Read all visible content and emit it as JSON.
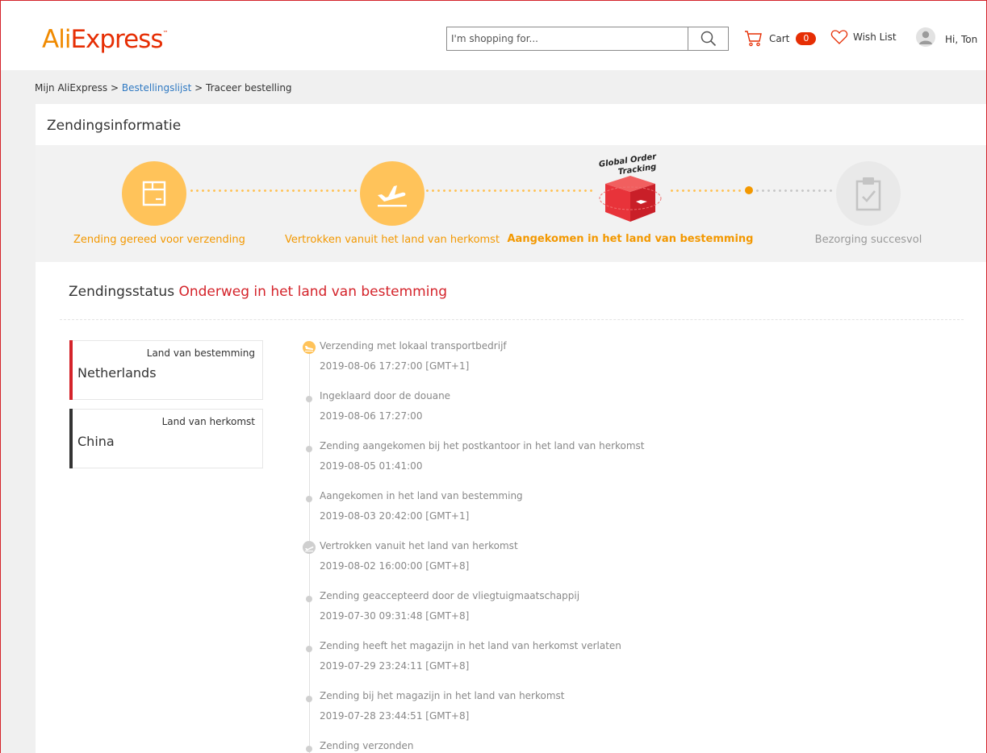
{
  "header": {
    "logo_text_ali": "Ali",
    "logo_text_express": "Express",
    "search_placeholder": "I'm shopping for...",
    "cart_label": "Cart",
    "cart_count": "0",
    "wishlist_label": "Wish List",
    "greeting": "Hi, Ton"
  },
  "breadcrumb": {
    "root": "Mijn AliExpress",
    "sep1": ">",
    "orders": "Bestellingslijst",
    "sep2": ">",
    "current": "Traceer bestelling"
  },
  "panel": {
    "title": "Zendingsinformatie"
  },
  "steps": [
    {
      "label": "Zending gereed voor verzending",
      "state": "done",
      "icon": "package-icon"
    },
    {
      "label": "Vertrokken vanuit het land van herkomst",
      "state": "done",
      "icon": "plane-departure-icon"
    },
    {
      "label": "Aangekomen in het land van bestemming",
      "state": "current",
      "icon": "global-order-tracking-icon",
      "badge_line1": "Global Order",
      "badge_line2": "Tracking"
    },
    {
      "label": "Bezorging succesvol",
      "state": "pending",
      "icon": "clipboard-check-icon"
    }
  ],
  "status": {
    "label": "Zendingsstatus",
    "value": "Onderweg in het land van bestemming"
  },
  "countries": {
    "destination": {
      "caption": "Land van bestemming",
      "name": "Netherlands",
      "accent": "#d4232a"
    },
    "origin": {
      "caption": "Land van herkomst",
      "name": "China",
      "accent": "#333333"
    }
  },
  "events": [
    {
      "desc": "Verzending met lokaal transportbedrijf",
      "time": "2019-08-06 17:27:00 [GMT+1]",
      "marker": "plane-landing-icon-active"
    },
    {
      "desc": "Ingeklaard door de douane",
      "time": "2019-08-06 17:27:00",
      "marker": "dot"
    },
    {
      "desc": "Zending aangekomen bij het postkantoor in het land van herkomst",
      "time": "2019-08-05 01:41:00",
      "marker": "dot"
    },
    {
      "desc": "Aangekomen in het land van bestemming",
      "time": "2019-08-03 20:42:00 [GMT+1]",
      "marker": "dot"
    },
    {
      "desc": "Vertrokken vanuit het land van herkomst",
      "time": "2019-08-02 16:00:00 [GMT+8]",
      "marker": "plane-takeoff-icon"
    },
    {
      "desc": "Zending geaccepteerd door de vliegtuigmaatschappij",
      "time": "2019-07-30 09:31:48 [GMT+8]",
      "marker": "dot"
    },
    {
      "desc": "Zending heeft het magazijn in het land van herkomst verlaten",
      "time": "2019-07-29 23:24:11 [GMT+8]",
      "marker": "dot"
    },
    {
      "desc": "Zending bij het magazijn in het land van herkomst",
      "time": "2019-07-28 23:44:51 [GMT+8]",
      "marker": "dot"
    },
    {
      "desc": "Zending verzonden",
      "time": "",
      "marker": "dot"
    }
  ],
  "colors": {
    "brand_red": "#e62e04",
    "brand_orange": "#f08a00",
    "step_done": "#ffc35a",
    "step_text": "#f39800",
    "link": "#2f79c2",
    "status_red": "#d4232a"
  }
}
